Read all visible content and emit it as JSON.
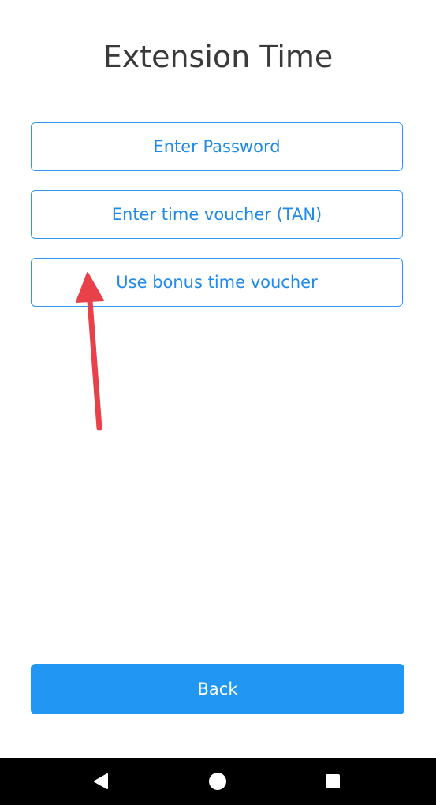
{
  "header": {
    "title": "Extension Time"
  },
  "options": [
    {
      "label": "Enter Password"
    },
    {
      "label": "Enter time voucher (TAN)"
    },
    {
      "label": "Use bonus time voucher"
    }
  ],
  "footer": {
    "back_label": "Back"
  },
  "colors": {
    "accent": "#2196F3",
    "annotation": "#E8414A",
    "title_text": "#3A3A3A",
    "nav_bar": "#000000"
  },
  "system_nav": {
    "icons": [
      "nav-back-icon",
      "nav-home-icon",
      "nav-recents-icon"
    ]
  }
}
